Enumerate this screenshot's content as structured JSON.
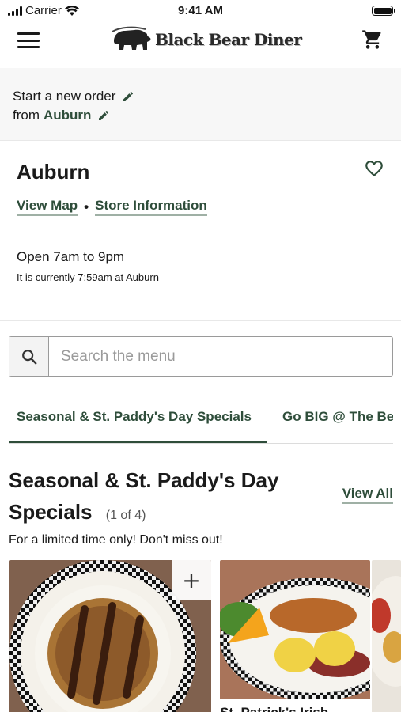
{
  "status_bar": {
    "carrier": "Carrier",
    "time": "9:41 AM"
  },
  "header": {
    "brand": "Black Bear Diner",
    "menu_icon": "hamburger-menu-icon",
    "cart_icon": "shopping-cart-icon"
  },
  "order": {
    "line1": "Start a new order",
    "line2_prefix": "from",
    "location": "Auburn"
  },
  "store": {
    "name": "Auburn",
    "view_map": "View Map",
    "separator": "•",
    "store_info": "Store Information",
    "hours": "Open 7am to 9pm",
    "current": "It is currently 7:59am at Auburn"
  },
  "search": {
    "placeholder": "Search the menu"
  },
  "tabs": [
    {
      "label": "Seasonal & St. Paddy's Day Specials",
      "active": true
    },
    {
      "label": "Go BIG @ The Bear",
      "active": false
    }
  ],
  "section": {
    "title": "Seasonal & St. Paddy's Day Specials",
    "count": "(1 of 4)",
    "view_all": "View All",
    "description": "For a limited time only! Don't miss out!"
  },
  "cards": [
    {
      "image": "pie-with-whipped-cream-image",
      "add_label": "+"
    },
    {
      "image": "eggs-benedict-plate-image",
      "label": "St. Patrick's Irish"
    },
    {
      "image": "salad-plate-image"
    }
  ],
  "colors": {
    "brand_green": "#2e4d3a",
    "banner_bg": "#f7f7f7"
  }
}
